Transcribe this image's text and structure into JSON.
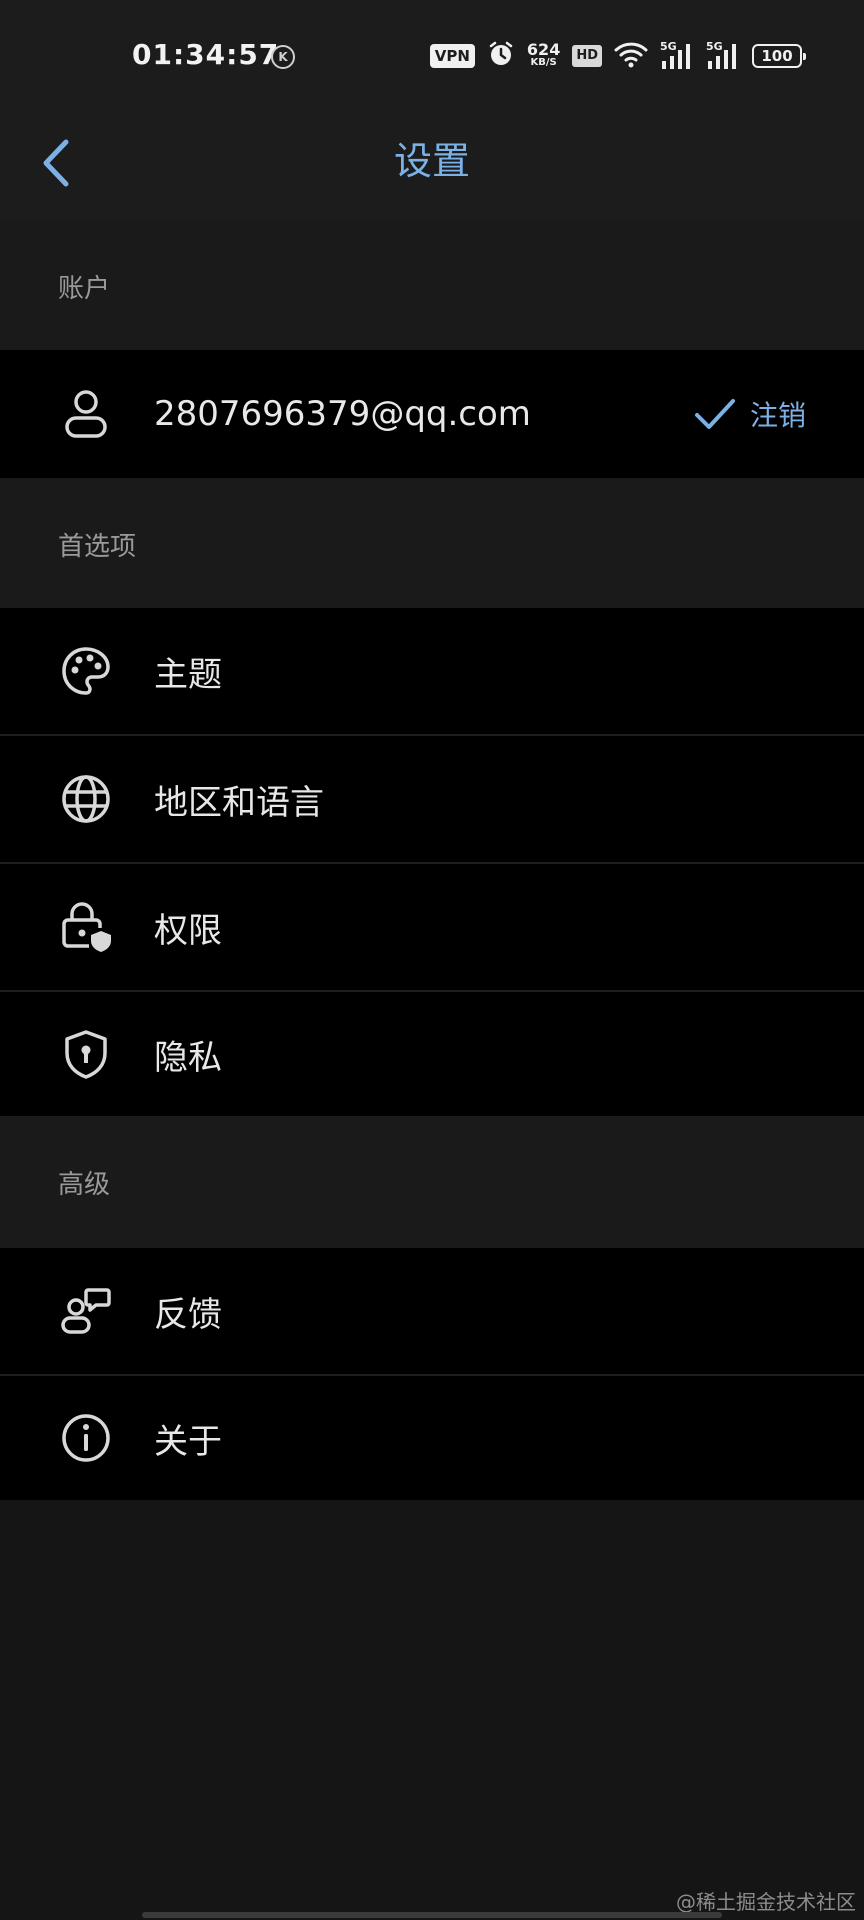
{
  "status_bar": {
    "time": "01:34:57",
    "k_badge": "K",
    "vpn": "VPN",
    "speed_value": "624",
    "speed_unit": "KB/S",
    "hd": "HD",
    "signal_1": "5G",
    "signal_2": "5G",
    "battery": "100"
  },
  "header": {
    "title": "设置"
  },
  "sections": {
    "account": {
      "title": "账户",
      "email": "2807696379@qq.com",
      "logout_label": "注销"
    },
    "preferences": {
      "title": "首选项",
      "items": [
        {
          "label": "主题",
          "icon": "palette-icon"
        },
        {
          "label": "地区和语言",
          "icon": "globe-icon"
        },
        {
          "label": "权限",
          "icon": "lock-shield-icon"
        },
        {
          "label": "隐私",
          "icon": "shield-keyhole-icon"
        }
      ]
    },
    "advanced": {
      "title": "高级",
      "items": [
        {
          "label": "反馈",
          "icon": "feedback-icon"
        },
        {
          "label": "关于",
          "icon": "info-icon"
        }
      ]
    }
  },
  "colors": {
    "accent": "#7cb1e6",
    "row_background": "#000000",
    "section_background": "#1a1a1a"
  },
  "watermark": "@稀土掘金技术社区"
}
